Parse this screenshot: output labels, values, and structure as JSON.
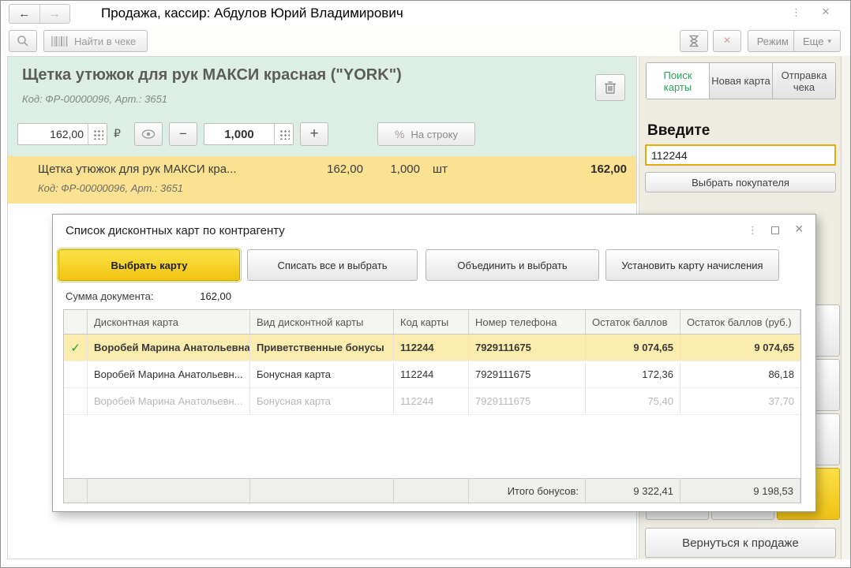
{
  "window": {
    "title": "Продажа, кассир: Абдулов Юрий Владимирович"
  },
  "icons": {
    "back": "←",
    "forward": "→",
    "kebab": "⋮",
    "close": "×",
    "red_x": "×",
    "dropdown": "▾",
    "minus": "−",
    "plus": "+",
    "check": "✓"
  },
  "toolbar": {
    "find_in_receipt": "Найти в чеке",
    "mode_label": "Режим",
    "more_label": "Еще"
  },
  "product": {
    "title": "Щетка утюжок для рук МАКСИ красная (\"YORK\")",
    "code_line": "Код: ФР-00000096, Арт.: 3651",
    "price": "162,00",
    "currency": "₽",
    "quantity": "1,000",
    "percent": "%",
    "per_line_label": "На строку"
  },
  "receipt_item": {
    "name": "Щетка утюжок для рук МАКСИ кра...",
    "price": "162,00",
    "quantity": "1,000",
    "unit": "шт",
    "total": "162,00",
    "code_line": "Код: ФР-00000096, Арт.: 3651"
  },
  "side_panel": {
    "tabs": [
      {
        "label": "Поиск карты",
        "active": true
      },
      {
        "label": "Новая карта",
        "active": false
      },
      {
        "label": "Отправка чека",
        "active": false
      }
    ],
    "enter_heading": "Введите",
    "card_input": {
      "value": "112244"
    },
    "select_customer_label": "Выбрать покупателя",
    "return_to_sale_label": "Вернуться к продаже"
  },
  "dialog": {
    "title": "Список дисконтных карт по контрагенту",
    "buttons": {
      "select_card": "Выбрать карту",
      "writeoff_all_select": "Списать все и выбрать",
      "merge_select": "Объединить и выбрать",
      "set_accrual_card": "Установить карту начисления"
    },
    "document_sum_label": "Сумма документа:",
    "document_sum_value": "162,00",
    "table": {
      "headers": [
        "Дисконтная карта",
        "Вид дисконтной карты",
        "Код карты",
        "Номер телефона",
        "Остаток баллов",
        "Остаток баллов (руб.)"
      ],
      "rows": [
        {
          "selected": true,
          "name": "Воробей Марина Анатольевна...",
          "type": "Приветственные бонусы",
          "code": "112244",
          "phone": "7929111675",
          "points": "9 074,65",
          "points_rub": "9 074,65"
        },
        {
          "selected": false,
          "name": "Воробей Марина Анатольевн...",
          "type": "Бонусная карта",
          "code": "112244",
          "phone": "7929111675",
          "points": "172,36",
          "points_rub": "86,18"
        },
        {
          "selected": false,
          "disabled": true,
          "name": "Воробей Марина Анатольевн...",
          "type": "Бонусная карта",
          "code": "112244",
          "phone": "7929111675",
          "points": "75,40",
          "points_rub": "37,70"
        }
      ],
      "footer": {
        "label": "Итого бонусов:",
        "points_total": "9 322,41",
        "points_rub_total": "9 198,53"
      }
    }
  },
  "colors": {
    "accent_yellow": "#f2c40f",
    "selected_row": "#fcecae",
    "item_row": "#fbe293",
    "product_panel": "#ddeee4",
    "side_panel": "#efece2",
    "active_tab_text": "#2f9e5a",
    "check_green": "#21a038",
    "input_focus_border": "#e2ab0c"
  }
}
